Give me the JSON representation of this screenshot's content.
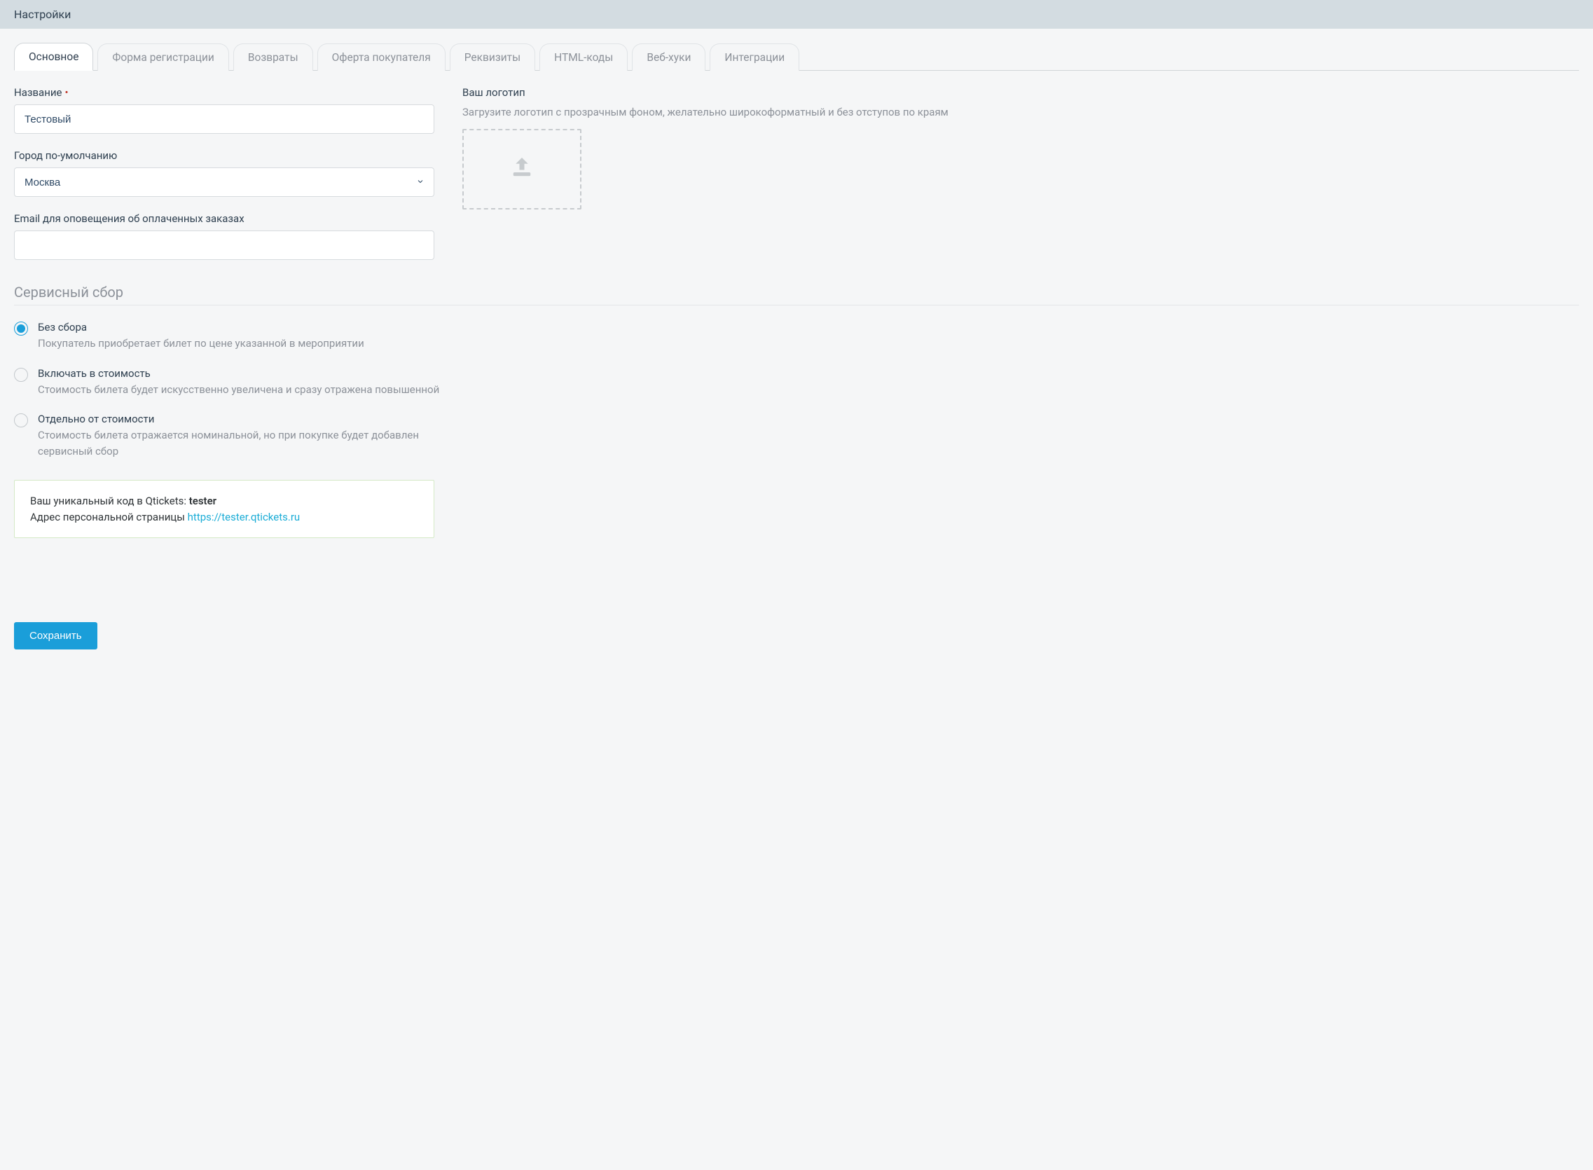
{
  "header": {
    "title": "Настройки"
  },
  "tabs": [
    {
      "label": "Основное",
      "active": true
    },
    {
      "label": "Форма регистрации",
      "active": false
    },
    {
      "label": "Возвраты",
      "active": false
    },
    {
      "label": "Оферта покупателя",
      "active": false
    },
    {
      "label": "Реквизиты",
      "active": false
    },
    {
      "label": "HTML-коды",
      "active": false
    },
    {
      "label": "Веб-хуки",
      "active": false
    },
    {
      "label": "Интеграции",
      "active": false
    }
  ],
  "form": {
    "name_label": "Название",
    "name_value": "Тестовый",
    "city_label": "Город по-умолчанию",
    "city_value": "Москва",
    "email_label": "Email для оповещения об оплаченных заказах",
    "email_value": ""
  },
  "logo": {
    "label": "Ваш логотип",
    "hint": "Загрузите логотип с прозрачным фоном, желательно широкоформатный и без отступов по краям"
  },
  "service_fee": {
    "title": "Сервисный сбор",
    "options": [
      {
        "label": "Без сбора",
        "desc": "Покупатель приобретает билет по цене указанной в мероприятии",
        "selected": true
      },
      {
        "label": "Включать в стоимость",
        "desc": "Стоимость билета будет искусственно увеличена и сразу отражена повышенной",
        "selected": false
      },
      {
        "label": "Отдельно от стоимости",
        "desc": "Стоимость билета отражается номинальной, но при покупке будет добавлен сервисный сбор",
        "selected": false
      }
    ]
  },
  "info": {
    "code_prefix": "Ваш уникальный код в Qtickets: ",
    "code_value": "tester",
    "url_prefix": "Адрес персональной страницы ",
    "url_value": "https://tester.qtickets.ru"
  },
  "buttons": {
    "save": "Сохранить"
  }
}
